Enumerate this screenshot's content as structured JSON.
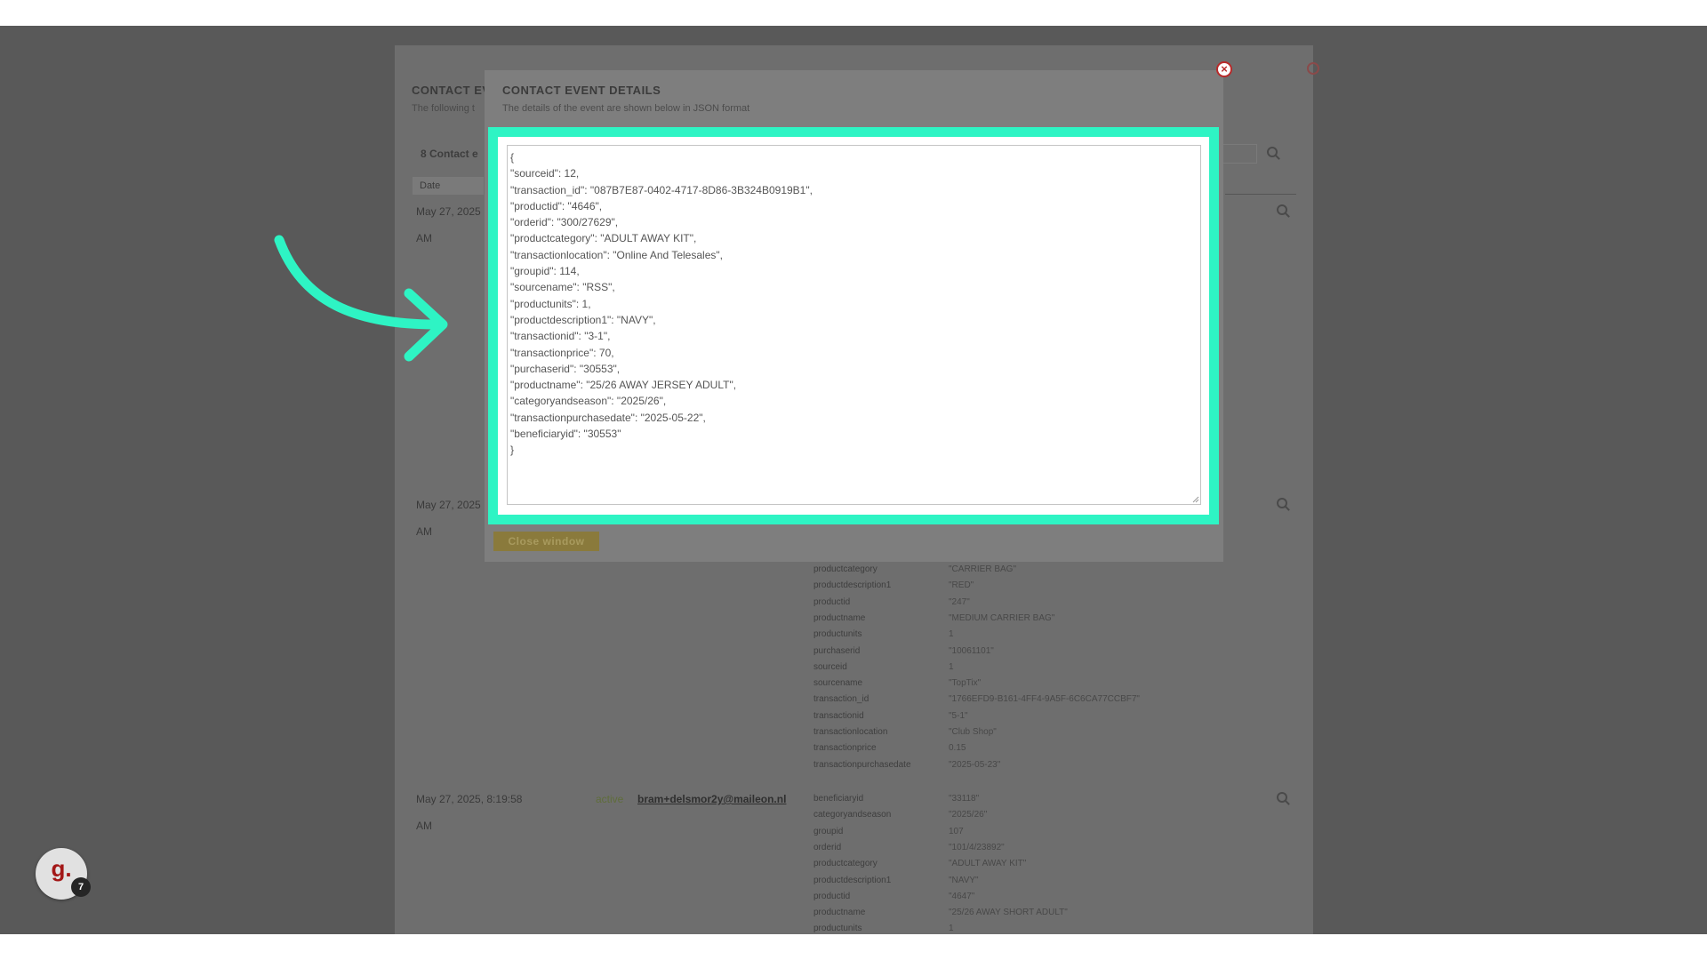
{
  "background": {
    "title": "CONTACT EV",
    "subtitle": "The following t",
    "count_label": "8 Contact e",
    "date_header": "Date",
    "rows": [
      {
        "date_line1": "May 27, 2025",
        "date_line2": "AM"
      },
      {
        "date_line1": "May 27, 2025",
        "date_line2": "AM"
      },
      {
        "date_line1": "May 27, 2025, 8:19:58",
        "date_line2": "AM",
        "status": "active",
        "email": "bram+delsmor2y@maileon.nl"
      }
    ],
    "details_row2": [
      {
        "key": "productcategory",
        "value": "\"CARRIER BAG\""
      },
      {
        "key": "productdescription1",
        "value": "\"RED\""
      },
      {
        "key": "productid",
        "value": "\"247\""
      },
      {
        "key": "productname",
        "value": "\"MEDIUM CARRIER BAG\""
      },
      {
        "key": "productunits",
        "value": "1"
      },
      {
        "key": "purchaserid",
        "value": "\"10061101\""
      },
      {
        "key": "sourceid",
        "value": "1"
      },
      {
        "key": "sourcename",
        "value": "\"TopTix\""
      },
      {
        "key": "transaction_id",
        "value": "\"1766EFD9-B161-4FF4-9A5F-6C6CA77CCBF7\""
      },
      {
        "key": "transactionid",
        "value": "\"5-1\""
      },
      {
        "key": "transactionlocation",
        "value": "\"Club Shop\""
      },
      {
        "key": "transactionprice",
        "value": "0.15"
      },
      {
        "key": "transactionpurchasedate",
        "value": "\"2025-05-23\""
      }
    ],
    "details_row3": [
      {
        "key": "beneficiaryid",
        "value": "\"33118\""
      },
      {
        "key": "categoryandseason",
        "value": "\"2025/26\""
      },
      {
        "key": "groupid",
        "value": "107"
      },
      {
        "key": "orderid",
        "value": "\"101/4/23892\""
      },
      {
        "key": "productcategory",
        "value": "\"ADULT AWAY KIT\""
      },
      {
        "key": "productdescription1",
        "value": "\"NAVY\""
      },
      {
        "key": "productid",
        "value": "\"4647\""
      },
      {
        "key": "productname",
        "value": "\"25/26 AWAY SHORT ADULT\""
      },
      {
        "key": "productunits",
        "value": "1"
      }
    ]
  },
  "modal": {
    "title": "CONTACT EVENT DETAILS",
    "subtitle": "The details of the event are shown below in JSON format",
    "json_text": "{\n\"sourceid\": 12,\n\"transaction_id\": \"087B7E87-0402-4717-8D86-3B324B0919B1\",\n\"productid\": \"4646\",\n\"orderid\": \"300/27629\",\n\"productcategory\": \"ADULT AWAY KIT\",\n\"transactionlocation\": \"Online And Telesales\",\n\"groupid\": 114,\n\"sourcename\": \"RSS\",\n\"productunits\": 1,\n\"productdescription1\": \"NAVY\",\n\"transactionid\": \"3-1\",\n\"transactionprice\": 70,\n\"purchaserid\": \"30553\",\n\"productname\": \"25/26 AWAY JERSEY ADULT\",\n\"categoryandseason\": \"2025/26\",\n\"transactionpurchasedate\": \"2025-05-22\",\n\"beneficiaryid\": \"30553\"\n}",
    "close_button_label": "Close window",
    "close_icon": "close-circle-icon"
  },
  "badge": {
    "letter": "g.",
    "count": "7"
  },
  "colors": {
    "highlight": "#2ef4c4",
    "arrow": "#2ef4c4",
    "close_icon": "#b82a2a",
    "badge_letter": "#a31717"
  }
}
